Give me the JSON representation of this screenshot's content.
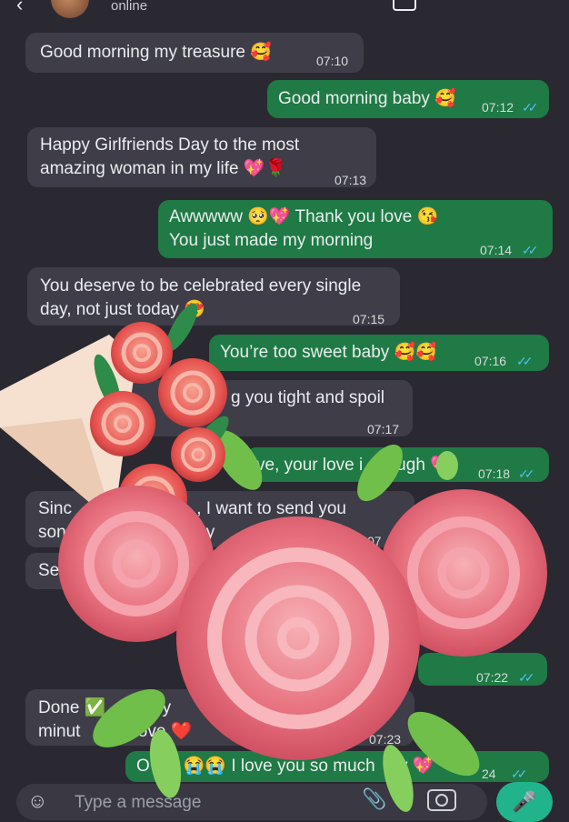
{
  "header": {
    "status": "online"
  },
  "messages": [
    {
      "dir": "in",
      "lines": [
        "Good morning my treasure 🥰"
      ],
      "time": "07:10"
    },
    {
      "dir": "out",
      "lines": [
        "Good morning baby 🥰"
      ],
      "time": "07:12"
    },
    {
      "dir": "in",
      "lines": [
        "Happy Girlfriends Day to the most",
        "amazing woman in my life 💖🌹"
      ],
      "time": "07:13"
    },
    {
      "dir": "out",
      "lines": [
        "Awwwww 🥺💖 Thank you love 😘",
        "You just made my morning"
      ],
      "time": "07:14"
    },
    {
      "dir": "in",
      "lines": [
        "You deserve to be celebrated every single",
        "day, not just today 😍"
      ],
      "time": "07:15"
    },
    {
      "dir": "out",
      "lines": [
        "You’re too sweet baby 🥰🥰"
      ],
      "time": "07:16"
    },
    {
      "dir": "in",
      "lines": [
        "g you tight and spoil"
      ],
      "time": "07:17"
    },
    {
      "dir": "out",
      "lines": [
        "ve, your love i     ough 💖"
      ],
      "time": "07:18"
    },
    {
      "dir": "in",
      "lines": [
        "Sinc                          , I want to send you",
        "son                       r day"
      ],
      "time": "07"
    },
    {
      "dir": "in",
      "lines": [
        "Ser"
      ],
      "time": ""
    },
    {
      "dir": "out",
      "lines": [
        ""
      ],
      "time": "07:22"
    },
    {
      "dir": "in",
      "lines": [
        "Done ✅         k y",
        "minut            ove ❤️"
      ],
      "time": "07:23"
    },
    {
      "dir": "out",
      "lines": [
        "O       😭😭 I love you so much   by 💖"
      ],
      "time": "24"
    }
  ],
  "composer": {
    "placeholder": "Type a message"
  },
  "icons": {
    "back": "back-arrow-icon",
    "emoji": "emoji-icon",
    "attach": "paperclip-icon",
    "camera": "camera-icon",
    "mic": "microphone-icon"
  },
  "colors": {
    "incoming": "#3f3d48",
    "outgoing": "#1f7a45",
    "background": "#2a2831",
    "ticks": "#53bdeb",
    "mic": "#21b48a"
  }
}
